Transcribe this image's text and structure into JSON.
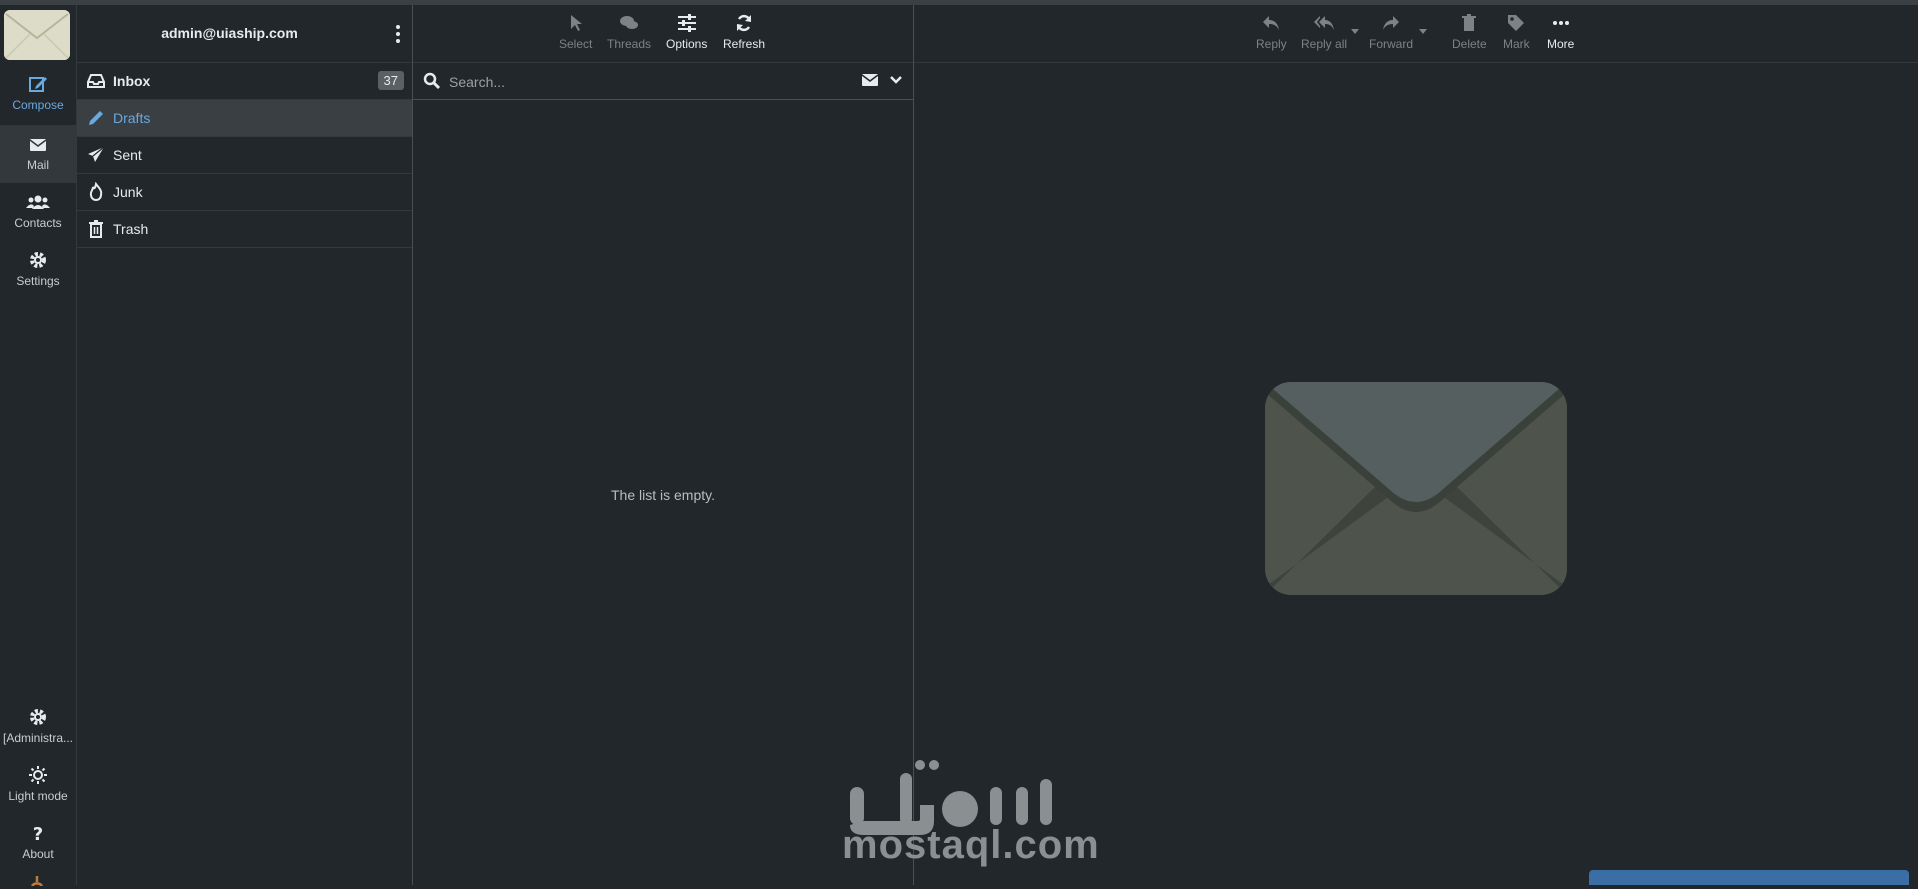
{
  "account": {
    "email": "admin@uiaship.com"
  },
  "nav": {
    "compose": "Compose",
    "mail": "Mail",
    "contacts": "Contacts",
    "settings": "Settings",
    "administration": "[Administra...",
    "light_mode": "Light mode",
    "about": "About"
  },
  "folders": [
    {
      "name": "Inbox",
      "count": "37",
      "icon": "inbox-icon"
    },
    {
      "name": "Drafts",
      "icon": "pencil-icon"
    },
    {
      "name": "Sent",
      "icon": "paper-plane-icon"
    },
    {
      "name": "Junk",
      "icon": "fire-icon"
    },
    {
      "name": "Trash",
      "icon": "trash-icon"
    }
  ],
  "list_toolbar": {
    "select": "Select",
    "threads": "Threads",
    "options": "Options",
    "refresh": "Refresh"
  },
  "search": {
    "placeholder": "Search..."
  },
  "list": {
    "empty_message": "The list is empty."
  },
  "message_toolbar": {
    "reply": "Reply",
    "reply_all": "Reply all",
    "forward": "Forward",
    "delete": "Delete",
    "mark": "Mark",
    "more": "More"
  },
  "watermark": {
    "text": "mostaql.com"
  },
  "colors": {
    "accent": "#6aa8e0",
    "background": "#22272b",
    "selected": "#3a3f43"
  }
}
